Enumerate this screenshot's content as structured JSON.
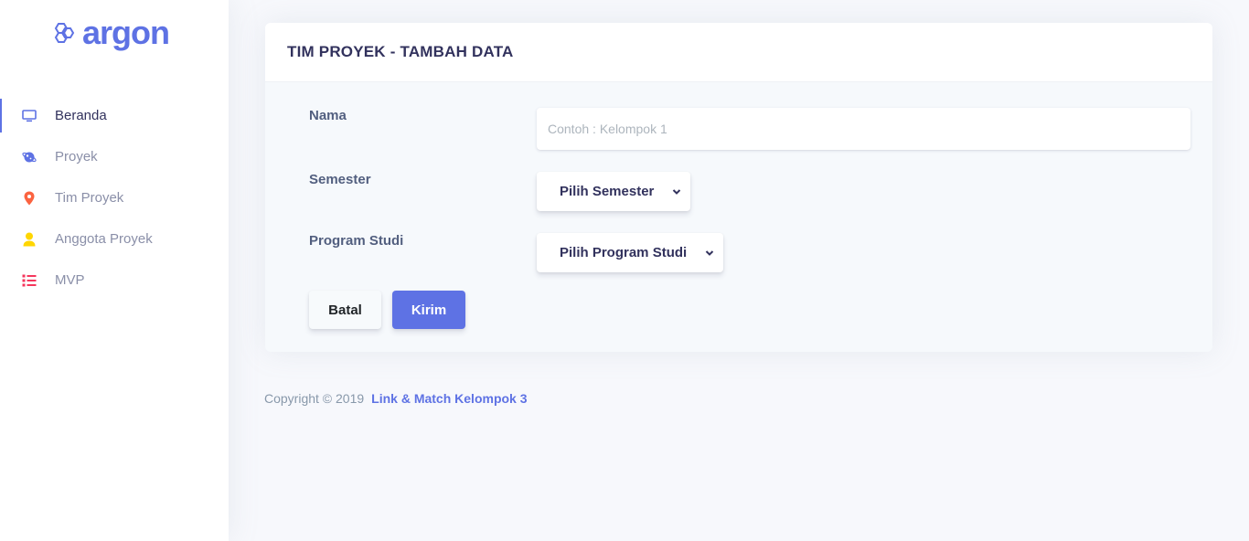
{
  "brand": {
    "name": "argon"
  },
  "sidebar": {
    "items": [
      {
        "label": "Beranda",
        "icon": "tv-icon",
        "color": "#5e72e4",
        "active": true
      },
      {
        "label": "Proyek",
        "icon": "planet-icon",
        "color": "#5e72e4",
        "active": false
      },
      {
        "label": "Tim Proyek",
        "icon": "pin-icon",
        "color": "#fb6340",
        "active": false
      },
      {
        "label": "Anggota Proyek",
        "icon": "user-icon",
        "color": "#ffd600",
        "active": false
      },
      {
        "label": "MVP",
        "icon": "list-icon",
        "color": "#f5365c",
        "active": false
      }
    ]
  },
  "card": {
    "title": "TIM PROYEK - TAMBAH DATA",
    "fields": {
      "nama": {
        "label": "Nama",
        "placeholder": "Contoh : Kelompok 1",
        "value": ""
      },
      "semester": {
        "label": "Semester",
        "selected": "Pilih Semester"
      },
      "prodi": {
        "label": "Program Studi",
        "selected": "Pilih Program Studi"
      }
    },
    "buttons": {
      "cancel": "Batal",
      "submit": "Kirim"
    }
  },
  "footer": {
    "copyright": "Copyright © 2019",
    "link": "Link & Match Kelompok 3"
  },
  "colors": {
    "primary": "#5e72e4",
    "background": "#f7f8fc"
  }
}
